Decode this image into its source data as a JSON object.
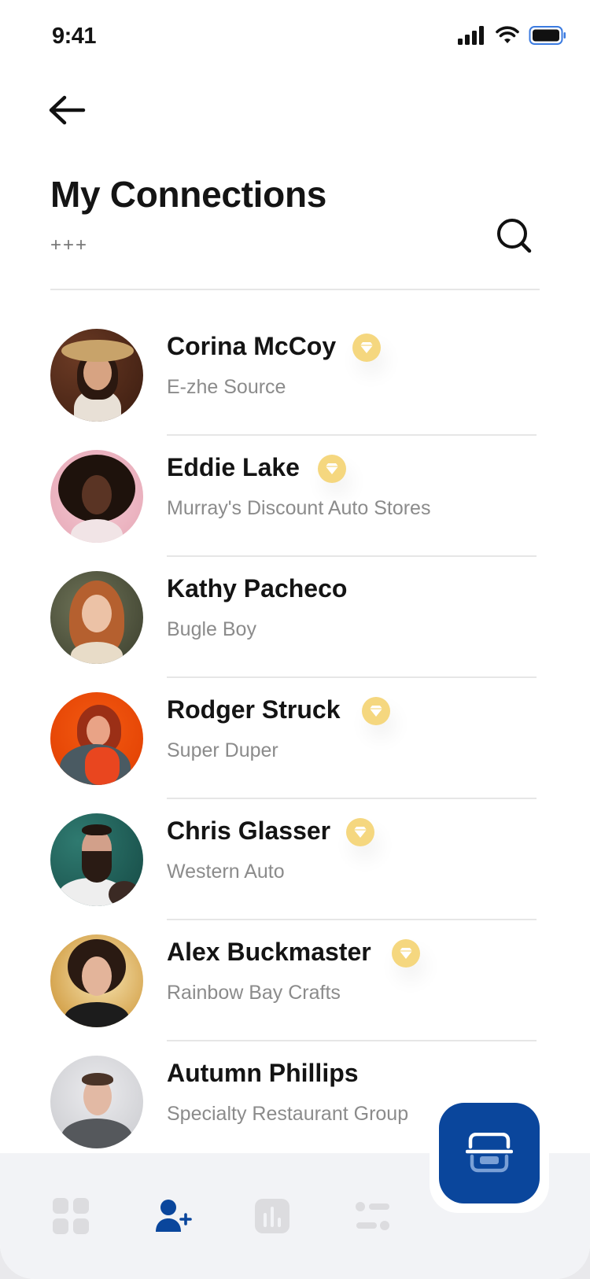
{
  "status_bar": {
    "time": "9:41"
  },
  "header": {
    "title": "My Connections",
    "subtitle": "+++"
  },
  "contacts": [
    {
      "name": "Corina McCoy",
      "company": "E-zhe Source",
      "premium": true
    },
    {
      "name": "Eddie Lake",
      "company": "Murray's Discount Auto Stores",
      "premium": true
    },
    {
      "name": "Kathy Pacheco",
      "company": "Bugle Boy",
      "premium": false
    },
    {
      "name": "Rodger Struck",
      "company": "Super Duper",
      "premium": true
    },
    {
      "name": "Chris Glasser",
      "company": "Western Auto",
      "premium": true
    },
    {
      "name": "Alex Buckmaster",
      "company": "Rainbow Bay Crafts",
      "premium": true
    },
    {
      "name": "Autumn Phillips",
      "company": "Specialty Restaurant Group",
      "premium": false
    }
  ],
  "tab_bar": {
    "tabs": [
      {
        "icon": "grid-icon",
        "active": false
      },
      {
        "icon": "add-user-icon",
        "active": true
      },
      {
        "icon": "chart-icon",
        "active": false
      },
      {
        "icon": "settings-icon",
        "active": false
      }
    ],
    "fab_icon": "scan-icon"
  },
  "colors": {
    "accent": "#0a469c",
    "premium_badge": "#f5d77f",
    "tab_inactive": "#dcdcdf",
    "text_primary": "#141414",
    "text_secondary": "#8b8b8b"
  }
}
